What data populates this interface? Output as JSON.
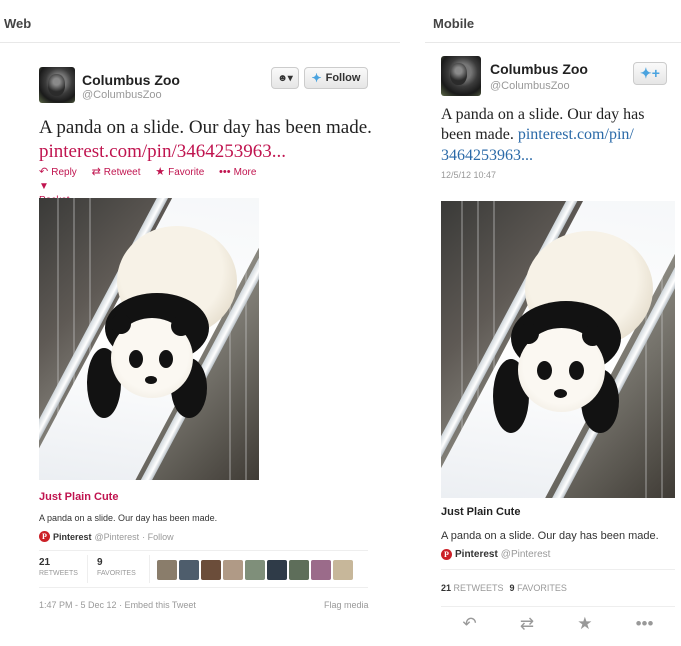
{
  "headers": {
    "web": "Web",
    "mobile": "Mobile"
  },
  "account": {
    "name": "Columbus Zoo",
    "handle": "@ColumbusZoo"
  },
  "tweet": {
    "text": "A panda on a slide. Our day has been made.",
    "link": "pinterest.com/pin/3464253963...",
    "link_mobile_a": "pinterest.com/pin/",
    "link_mobile_b": "3464253963..."
  },
  "web": {
    "follow_label": "Follow",
    "actions": {
      "reply": "Reply",
      "retweet": "Retweet",
      "favorite": "Favorite",
      "more": "More",
      "pocket": "Pocket"
    },
    "card": {
      "title": "Just Plain Cute",
      "description": "A panda on a slide. Our day has been made.",
      "source_name": "Pinterest",
      "source_handle": "@Pinterest",
      "source_follow": "· Follow"
    },
    "stats": {
      "retweets": "21",
      "retweets_label": "RETWEETS",
      "favorites": "9",
      "favorites_label": "FAVORITES"
    },
    "timestamp": "1:47 PM - 5 Dec 12",
    "embed": "· Embed this Tweet",
    "flag": "Flag media"
  },
  "mobile": {
    "timestamp": "12/5/12 10:47",
    "card": {
      "title": "Just Plain Cute",
      "description": "A panda on a slide. Our day has been made.",
      "source_name": "Pinterest",
      "source_handle": "@Pinterest"
    },
    "stats": {
      "retweets": "21",
      "retweets_label": "RETWEETS",
      "favorites": "9",
      "favorites_label": "FAVORITES"
    }
  },
  "icons": {
    "reply": "reply-icon",
    "retweet": "retweet-icon",
    "favorite": "star-icon",
    "more": "more-icon",
    "pocket": "pocket-icon",
    "bird": "twitter-bird-icon",
    "user": "user-icon"
  },
  "colors": {
    "accent_red": "#c0144f",
    "link_blue": "#2b6aa8",
    "twitter_blue": "#4aa3df",
    "pinterest_red": "#cb2027"
  }
}
